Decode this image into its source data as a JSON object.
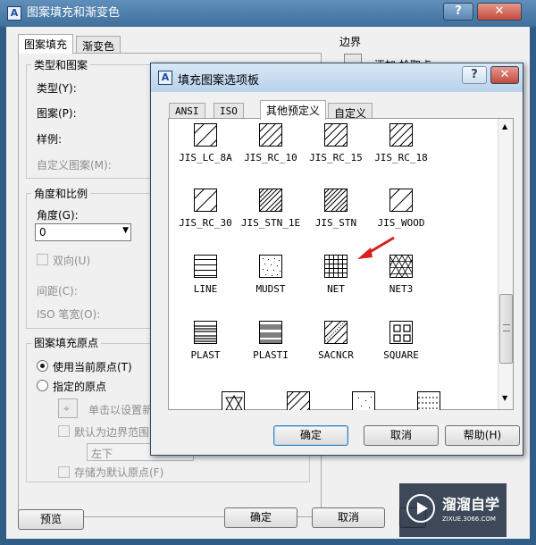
{
  "main_dialog": {
    "title": "图案填充和渐变色",
    "help_button": "?",
    "close_button": "✕",
    "tabs": [
      "图案填充",
      "渐变色"
    ],
    "type_group": {
      "legend": "类型和图案",
      "type_label": "类型(Y):",
      "pattern_label": "图案(P):",
      "sample_label": "样例:",
      "custom_label": "自定义图案(M):"
    },
    "angle_group": {
      "legend": "角度和比例",
      "angle_label": "角度(G):",
      "angle_value": "0",
      "double_label": "双向(U)",
      "spacing_label": "间距(C):",
      "iso_label": "ISO 笔宽(O):"
    },
    "origin_group": {
      "legend": "图案填充原点",
      "use_current": "使用当前原点(T)",
      "specified": "指定的原点",
      "click_set": "单击以设置新原点",
      "default_boundary": "默认为边界范围(X)",
      "position_value": "左下",
      "store_default": "存储为默认原点(F)"
    },
    "boundary_group": {
      "legend": "边界",
      "add_pick": "添加:拾取点"
    },
    "buttons": {
      "preview": "预览",
      "ok": "确定",
      "cancel": "取消"
    }
  },
  "palette": {
    "title": "填充图案选项板",
    "help_button": "?",
    "close_button": "✕",
    "tabs": [
      "ANSI",
      "ISO",
      "其他预定义",
      "自定义"
    ],
    "active_tab": "其他预定义",
    "patterns": [
      {
        "label": "JIS_LC_8A",
        "icon": "diag-sparse"
      },
      {
        "label": "JIS_RC_10",
        "icon": "diag"
      },
      {
        "label": "JIS_RC_15",
        "icon": "diag"
      },
      {
        "label": "JIS_RC_18",
        "icon": "diag"
      },
      {
        "label": "JIS_RC_30",
        "icon": "diag-sparse"
      },
      {
        "label": "JIS_STN_1E",
        "icon": "diag-dense"
      },
      {
        "label": "JIS_STN",
        "icon": "diag-dense"
      },
      {
        "label": "JIS_WOOD",
        "icon": "diag-sparse"
      },
      {
        "label": "LINE",
        "icon": "hlines"
      },
      {
        "label": "MUDST",
        "icon": "dots"
      },
      {
        "label": "NET",
        "icon": "grid"
      },
      {
        "label": "NET3",
        "icon": "triangles"
      },
      {
        "label": "PLAST",
        "icon": "plast"
      },
      {
        "label": "PLASTI",
        "icon": "plasti"
      },
      {
        "label": "SACNCR",
        "icon": "sacncr"
      },
      {
        "label": "SQUARE",
        "icon": "square"
      }
    ],
    "buttons": {
      "ok": "确定",
      "cancel": "取消",
      "help": "帮助(H)"
    }
  },
  "watermark": {
    "name": "溜溜自学",
    "url": "ZIXUE.3066.COM"
  },
  "colors": {
    "annotation_arrow": "#d81e1e",
    "title_blue": "#3f6f9c"
  }
}
